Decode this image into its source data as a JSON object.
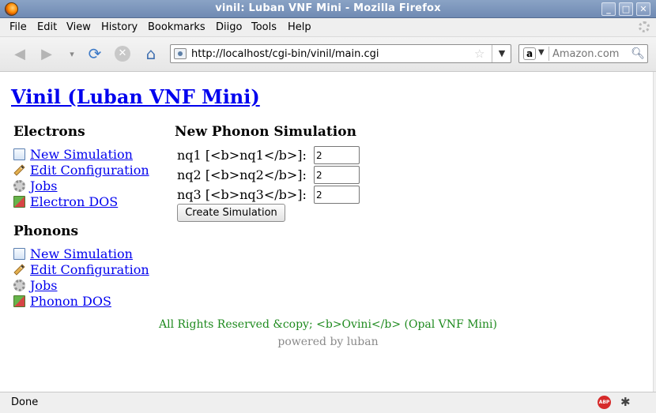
{
  "window": {
    "title": "vinil: Luban VNF Mini - Mozilla Firefox",
    "minimize_glyph": "_",
    "maximize_glyph": "□",
    "close_glyph": "✕"
  },
  "menu": [
    "File",
    "Edit",
    "View",
    "History",
    "Bookmarks",
    "Diigo",
    "Tools",
    "Help"
  ],
  "toolbar": {
    "url": "http://localhost/cgi-bin/vinil/main.cgi",
    "search_placeholder": "Amazon.com",
    "search_engine_letter": "a"
  },
  "page": {
    "heading": "Vinil (Luban VNF Mini)",
    "electrons": {
      "title": "Electrons",
      "items": [
        "New Simulation",
        "Edit Configuration",
        "Jobs",
        "Electron DOS"
      ]
    },
    "phonons": {
      "title": "Phonons",
      "items": [
        "New Simulation",
        "Edit Configuration",
        "Jobs",
        "Phonon DOS"
      ]
    },
    "form": {
      "title": "New Phonon Simulation",
      "fields": [
        {
          "label": "nq1 [<b>nq1</b>]:",
          "value": "2"
        },
        {
          "label": "nq2 [<b>nq2</b>]:",
          "value": "2"
        },
        {
          "label": "nq3 [<b>nq3</b>]:",
          "value": "2"
        }
      ],
      "submit_label": "Create Simulation"
    },
    "footer": {
      "rights": "All Rights Reserved &copy; <b>Ovini</b> (Opal VNF Mini)",
      "powered": "powered by luban"
    }
  },
  "status": {
    "text": "Done",
    "abp_label": "ABP"
  },
  "colors": {
    "link": "#0000ee",
    "footer_green": "#1e8a1e",
    "titlebar": "#7f97bd"
  }
}
